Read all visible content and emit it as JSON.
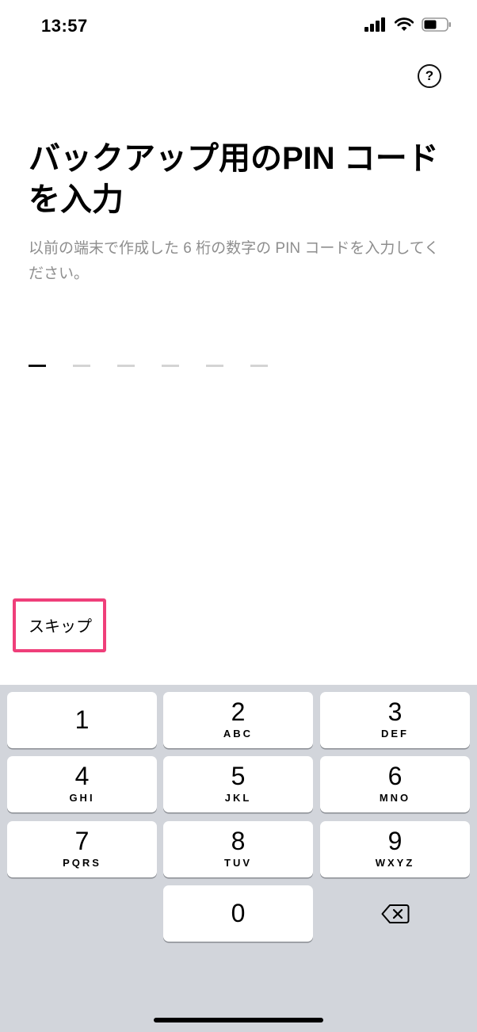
{
  "status_bar": {
    "time": "13:57"
  },
  "header": {
    "help_icon_glyph": "?"
  },
  "main": {
    "title_line1": "バックアップ用のPIN コード",
    "title_line2": "を入力",
    "description": "以前の端末で作成した 6 桁の数字の PIN コードを入力してください。",
    "pin_length": 6,
    "pin_entered": 0
  },
  "skip": {
    "label": "スキップ",
    "highlight_color": "#ef3f7a"
  },
  "keypad": {
    "keys": [
      {
        "num": "1",
        "letters": ""
      },
      {
        "num": "2",
        "letters": "ABC"
      },
      {
        "num": "3",
        "letters": "DEF"
      },
      {
        "num": "4",
        "letters": "GHI"
      },
      {
        "num": "5",
        "letters": "JKL"
      },
      {
        "num": "6",
        "letters": "MNO"
      },
      {
        "num": "7",
        "letters": "PQRS"
      },
      {
        "num": "8",
        "letters": "TUV"
      },
      {
        "num": "9",
        "letters": "WXYZ"
      },
      {
        "num": "0",
        "letters": ""
      }
    ],
    "backspace_icon": "delete-icon"
  }
}
